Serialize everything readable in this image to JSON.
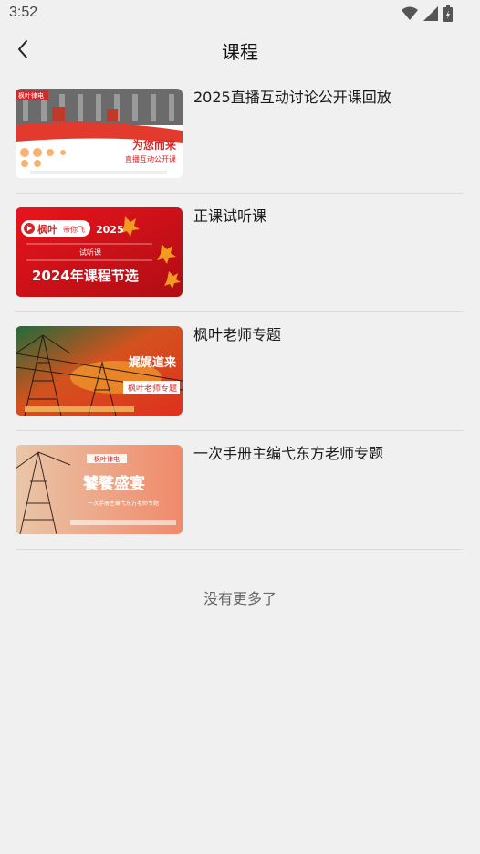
{
  "status_bar": {
    "time": "3:52"
  },
  "header": {
    "title": "课程"
  },
  "courses": [
    {
      "title": "2025直播互动讨论公开课回放",
      "thumb": {
        "line1": "为您而来",
        "line2": "直播互动公开课",
        "logo": "枫叶律电"
      }
    },
    {
      "title": "正课试听课",
      "thumb": {
        "brand": "枫叶",
        "sub": "带你飞",
        "year": "2025",
        "tag": "试听课",
        "main": "2024年课程节选"
      }
    },
    {
      "title": "枫叶老师专题",
      "thumb": {
        "main": "娓娓道来",
        "sub": "枫叶老师专题"
      }
    },
    {
      "title": "一次手册主编弋东方老师专题",
      "thumb": {
        "logo": "枫叶律电",
        "main": "饕餮盛宴",
        "sub": "一次手册主编弋东方老师专题"
      }
    }
  ],
  "footer": {
    "no_more": "没有更多了"
  }
}
